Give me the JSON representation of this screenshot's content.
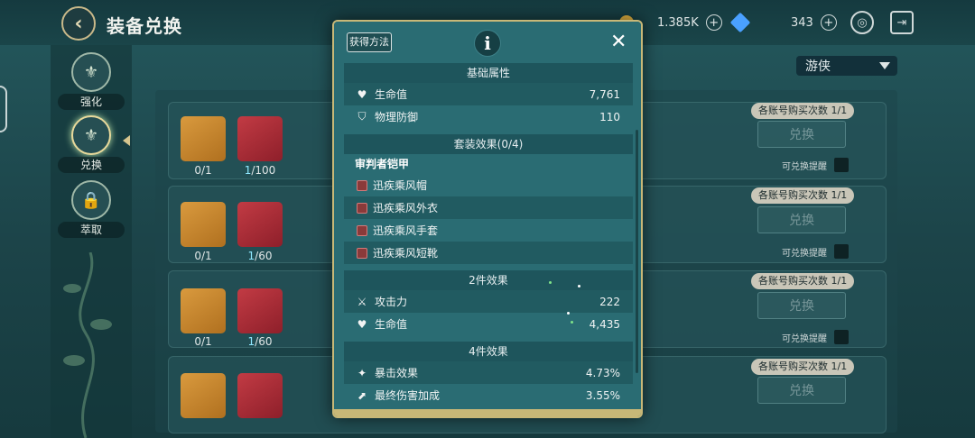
{
  "topbar": {
    "title": "装备兑换",
    "back_icon": "back-arrow-icon",
    "gold_amount": "1.385K",
    "gem_amount": "343",
    "plus": "+"
  },
  "sidebar": {
    "items": [
      {
        "label": "强化",
        "icon": "trident-icon",
        "glyph": "⚜"
      },
      {
        "label": "兑换",
        "icon": "trident-icon",
        "glyph": "⚜"
      },
      {
        "label": "萃取",
        "icon": "lock-icon",
        "glyph": "🔒"
      }
    ]
  },
  "class_select": {
    "value": "游侠"
  },
  "rows": [
    {
      "count1": "0/1",
      "count2_have": "1",
      "count2_need": "/100",
      "limit": "各账号购买次数 1/1",
      "button": "兑换",
      "remind": "可兑换提醒"
    },
    {
      "count1": "0/1",
      "count2_have": "1",
      "count2_need": "/60",
      "limit": "各账号购买次数 1/1",
      "button": "兑换",
      "remind": "可兑换提醒"
    },
    {
      "count1": "0/1",
      "count2_have": "1",
      "count2_need": "/60",
      "limit": "各账号购买次数 1/1",
      "button": "兑换",
      "remind": "可兑换提醒"
    },
    {
      "count1": "",
      "count2_have": "",
      "count2_need": "",
      "limit": "各账号购买次数 1/1",
      "button": "兑换",
      "remind": ""
    }
  ],
  "modal": {
    "source_button": "获得方法",
    "info_glyph": "i",
    "close_glyph": "✕",
    "base_header": "基础属性",
    "base_stats": [
      {
        "icon": "heart-icon",
        "glyph": "♥",
        "name": "生命值",
        "value": "7,761"
      },
      {
        "icon": "shield-icon",
        "glyph": "⛉",
        "name": "物理防御",
        "value": "110"
      }
    ],
    "set_header": "套装效果(0/4)",
    "set_name": "审判者铠甲",
    "set_pieces": [
      "迅疾乘风帽",
      "迅疾乘风外衣",
      "迅疾乘风手套",
      "迅疾乘风短靴"
    ],
    "bonus2_header": "2件效果",
    "bonus2_stats": [
      {
        "icon": "crossed-swords-icon",
        "glyph": "⚔",
        "name": "攻击力",
        "value": "222"
      },
      {
        "icon": "heart-icon",
        "glyph": "♥",
        "name": "生命值",
        "value": "4,435"
      }
    ],
    "bonus4_header": "4件效果",
    "bonus4_stats": [
      {
        "icon": "critical-effect-icon",
        "glyph": "✦",
        "name": "暴击效果",
        "value": "4.73%"
      },
      {
        "icon": "final-damage-icon",
        "glyph": "⬈",
        "name": "最终伤害加成",
        "value": "3.55%"
      }
    ]
  }
}
